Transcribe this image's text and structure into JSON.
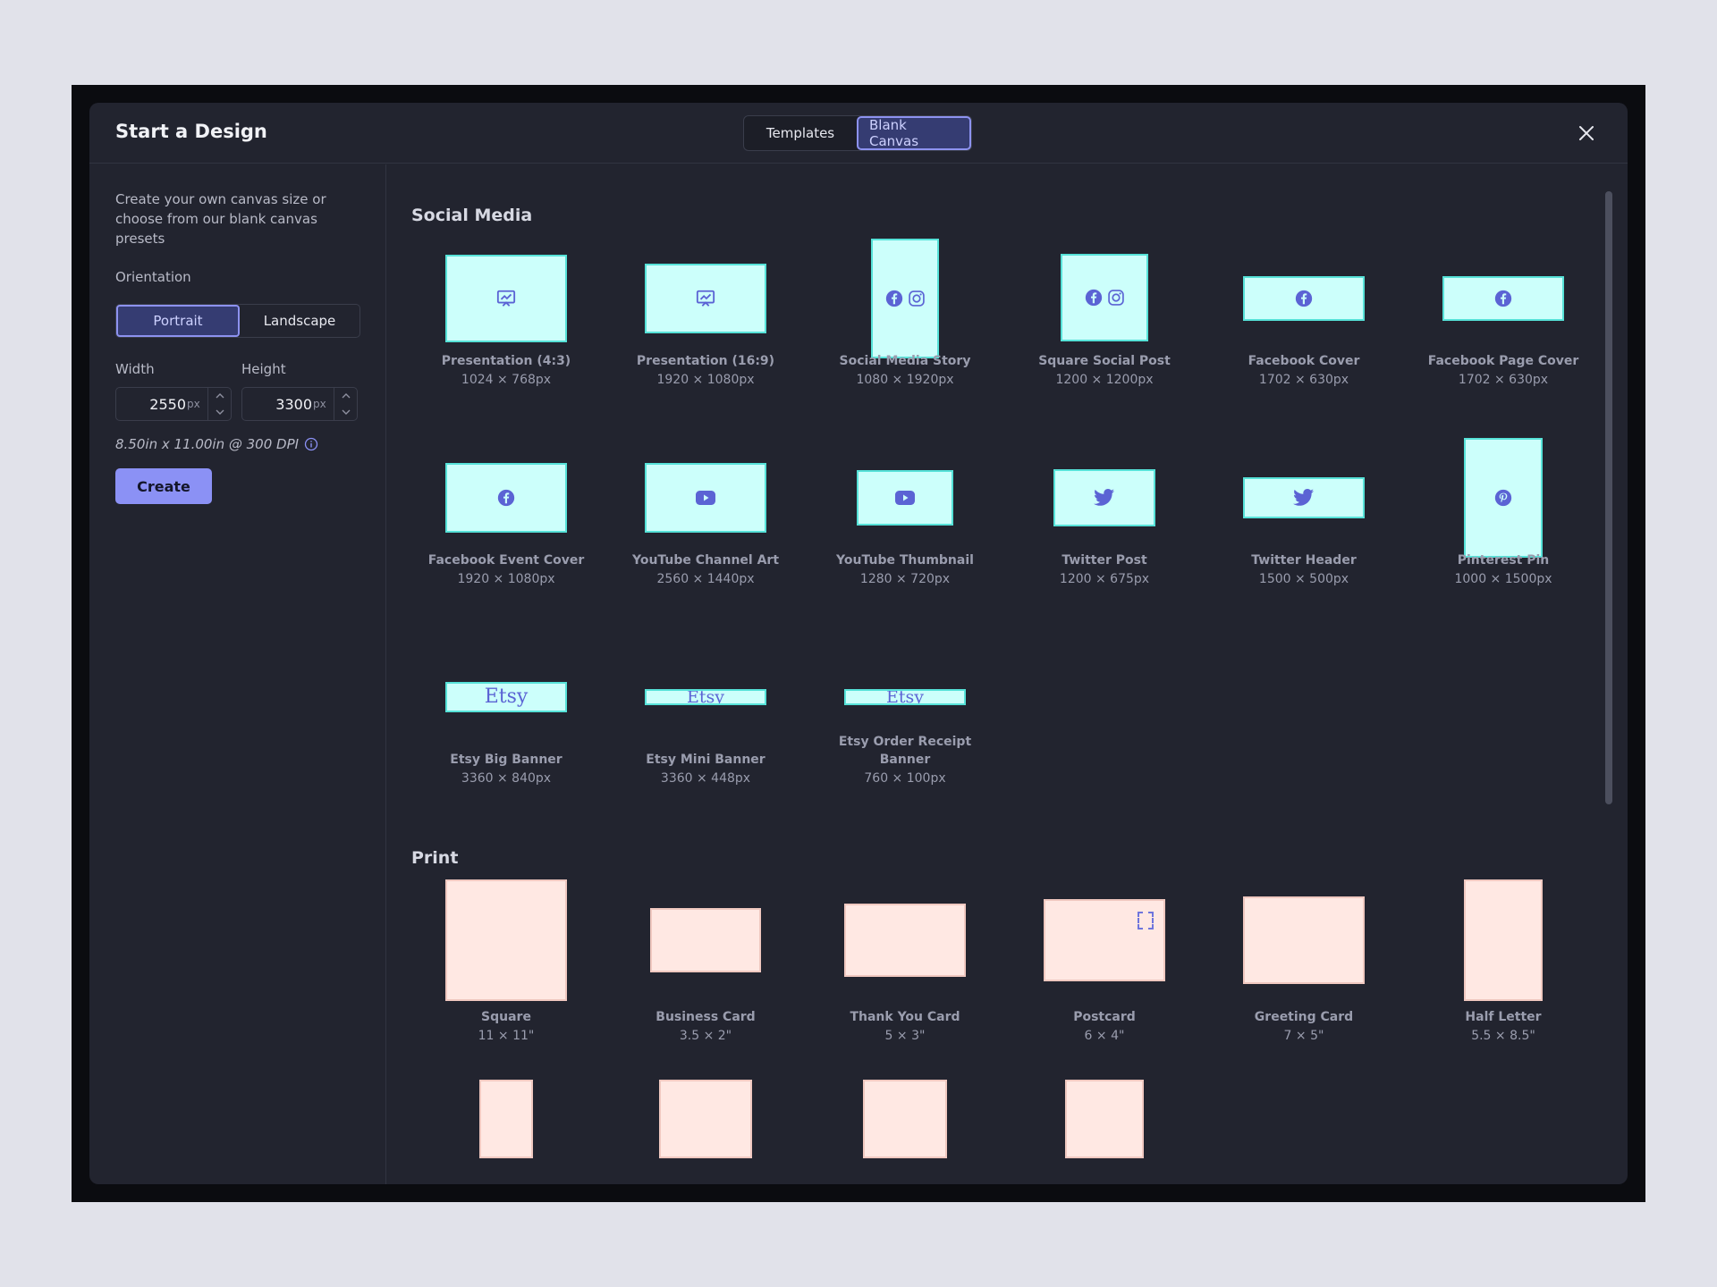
{
  "header": {
    "title": "Start a Design",
    "tabs": [
      "Templates",
      "Blank Canvas"
    ],
    "active_tab": "Blank Canvas"
  },
  "sidebar": {
    "intro": "Create your own canvas size or choose from our blank canvas presets",
    "orientation_label": "Orientation",
    "orientation_options": [
      "Portrait",
      "Landscape"
    ],
    "selected_orientation": "Portrait",
    "width_label": "Width",
    "height_label": "Height",
    "width_value": "2550",
    "height_value": "3300",
    "unit": "px",
    "dpi_text": "8.50in x 11.00in @ 300 DPI",
    "create_label": "Create"
  },
  "sections": {
    "social_media": "Social Media",
    "print": "Print"
  },
  "social_items": [
    {
      "name": "Presentation (4:3)",
      "dims": "1024 × 768px",
      "icon": "presentation-icon"
    },
    {
      "name": "Presentation (16:9)",
      "dims": "1920 × 1080px",
      "icon": "presentation-icon"
    },
    {
      "name": "Social Media Story",
      "dims": "1080 × 1920px",
      "icon": "facebook-instagram-icons"
    },
    {
      "name": "Square Social Post",
      "dims": "1200 × 1200px",
      "icon": "facebook-instagram-icons"
    },
    {
      "name": "Facebook Cover",
      "dims": "1702 × 630px",
      "icon": "facebook-icon"
    },
    {
      "name": "Facebook Page Cover",
      "dims": "1702 × 630px",
      "icon": "facebook-icon"
    },
    {
      "name": "Facebook Event Cover",
      "dims": "1920 × 1080px",
      "icon": "facebook-icon"
    },
    {
      "name": "YouTube Channel Art",
      "dims": "2560 × 1440px",
      "icon": "youtube-icon"
    },
    {
      "name": "YouTube Thumbnail",
      "dims": "1280 × 720px",
      "icon": "youtube-icon"
    },
    {
      "name": "Twitter Post",
      "dims": "1200 × 675px",
      "icon": "twitter-icon"
    },
    {
      "name": "Twitter Header",
      "dims": "1500 × 500px",
      "icon": "twitter-icon"
    },
    {
      "name": "Pinterest Pin",
      "dims": "1000 × 1500px",
      "icon": "pinterest-icon"
    },
    {
      "name": "Etsy Big Banner",
      "dims": "3360 × 840px",
      "icon": "etsy-logo",
      "logo_text": "Etsy"
    },
    {
      "name": "Etsy Mini Banner",
      "dims": "3360 × 448px",
      "icon": "etsy-logo",
      "logo_text": "Etsy"
    },
    {
      "name": "Etsy Order Receipt Banner",
      "dims": "760 × 100px",
      "icon": "etsy-logo",
      "logo_text": "Etsy"
    }
  ],
  "print_items": [
    {
      "name": "Square",
      "dims": "11 × 11\""
    },
    {
      "name": "Business Card",
      "dims": "3.5 × 2\""
    },
    {
      "name": "Thank You Card",
      "dims": "5 × 3\""
    },
    {
      "name": "Postcard",
      "dims": "6 × 4\""
    },
    {
      "name": "Greeting Card",
      "dims": "7 × 5\""
    },
    {
      "name": "Half Letter",
      "dims": "5.5 × 8.5\""
    }
  ],
  "colors": {
    "accent": "#8b91f5",
    "social_fill": "#ccfffb",
    "social_border": "#56e2d8",
    "print_fill": "#ffe8e3",
    "icon": "#5b63d4"
  }
}
